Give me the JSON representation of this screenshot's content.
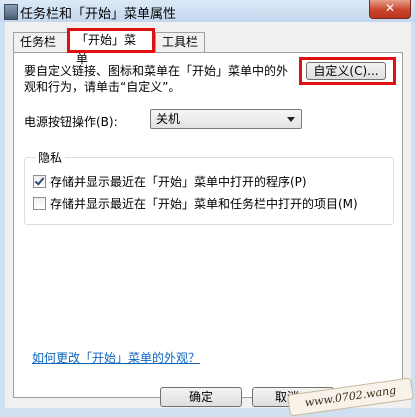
{
  "window": {
    "title": "任务栏和「开始」菜单属性",
    "close_label": "✕"
  },
  "tabs": [
    {
      "label": "任务栏"
    },
    {
      "label": "「开始」菜单"
    },
    {
      "label": "工具栏"
    }
  ],
  "start_menu": {
    "description": "要自定义链接、图标和菜单在「开始」菜单中的外观和行为，请单击“自定义”。",
    "customize_label": "自定义(C)...",
    "power_label": "电源按钮操作(B):",
    "power_value": "关机"
  },
  "privacy": {
    "title": "隐私",
    "options": [
      {
        "label": "存储并显示最近在「开始」菜单中打开的程序(P)",
        "checked": true
      },
      {
        "label": "存储并显示最近在「开始」菜单和任务栏中打开的项目(M)",
        "checked": false
      }
    ]
  },
  "help_link": "如何更改「开始」菜单的外观？",
  "buttons": {
    "ok": "确定",
    "cancel": "取消"
  },
  "watermark": "www.0702.wang",
  "colors": {
    "highlight": "#e01010",
    "link": "#0b64c0"
  }
}
